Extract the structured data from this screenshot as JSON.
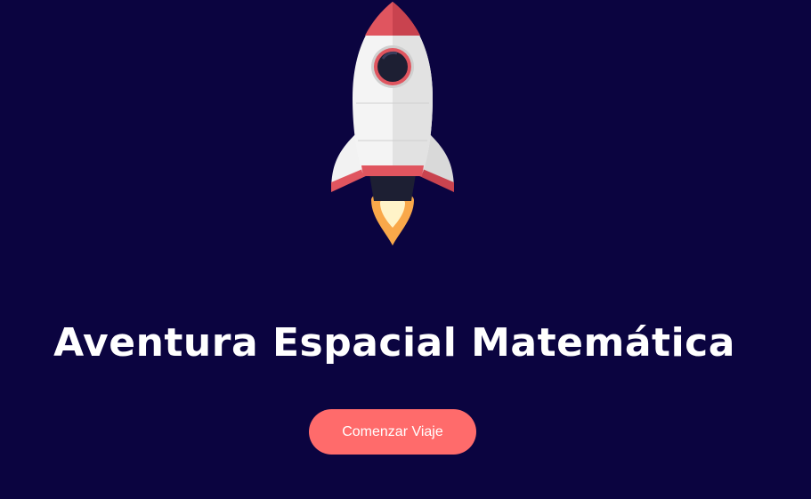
{
  "hero": {
    "icon": "rocket-icon",
    "title": "Aventura Espacial Matemática",
    "start_button": "Comenzar Viaje"
  },
  "colors": {
    "background": "#0b0440",
    "button": "#ff6b6b",
    "rocket_accent": "#e0555f",
    "flame": "#f9a84a"
  }
}
